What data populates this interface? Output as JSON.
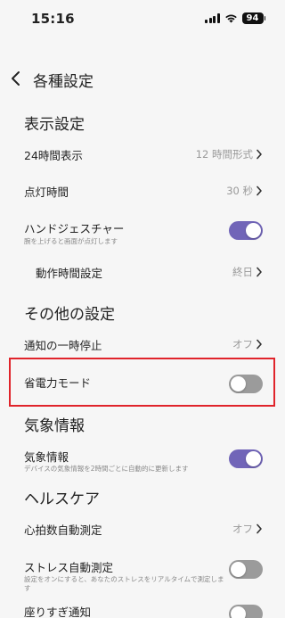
{
  "status_bar": {
    "time": "15:16",
    "battery": "94",
    "icons": [
      "signal-icon",
      "wifi-icon",
      "battery-icon"
    ]
  },
  "header": {
    "title": "各種設定",
    "back_icon": "chevron-left-icon"
  },
  "sections": {
    "display": {
      "heading": "表示設定",
      "time_format": {
        "label": "24時間表示",
        "value": "12 時間形式"
      },
      "light_duration": {
        "label": "点灯時間",
        "value": "30 秒"
      },
      "hand_gesture": {
        "label": "ハンドジェスチャー",
        "sub": "腕を上げると画面が点灯します",
        "enabled": true
      },
      "active_time": {
        "label": "動作時間設定",
        "value": "終日"
      }
    },
    "other": {
      "heading": "その他の設定",
      "pause_notifications": {
        "label": "通知の一時停止",
        "value": "オフ"
      },
      "power_saving": {
        "label": "省電力モード",
        "enabled": false
      }
    },
    "weather": {
      "heading": "気象情報",
      "weather_info": {
        "label": "気象情報",
        "sub": "デバイスの気象情報を2時間ごとに自動的に更新します",
        "enabled": true
      }
    },
    "health": {
      "heading": "ヘルスケア",
      "heart_rate": {
        "label": "心拍数自動測定",
        "value": "オフ"
      },
      "stress": {
        "label": "ストレス自動測定",
        "sub": "設定をオンにすると、あなたのストレスをリアルタイムで測定します",
        "enabled": false
      },
      "sedentary": {
        "label": "座りすぎ通知",
        "enabled": false
      }
    }
  },
  "colors": {
    "toggle_on": "#7165b8",
    "toggle_off": "#9b9b9b",
    "highlight": "#e0242b",
    "background": "#f6f6f6"
  }
}
